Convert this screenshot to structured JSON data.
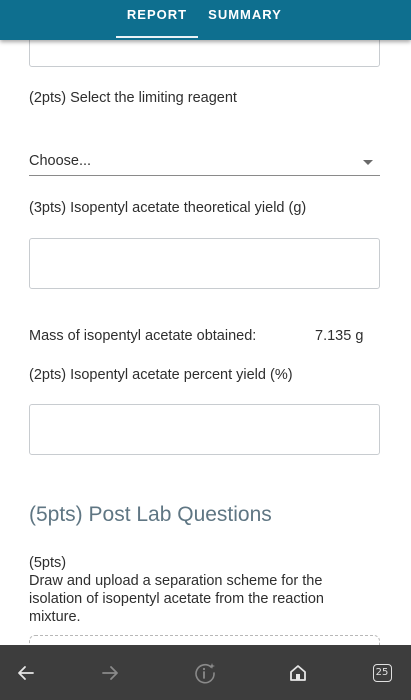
{
  "tabs": [
    {
      "label": "REPORT",
      "active": true
    },
    {
      "label": "SUMMARY",
      "active": false
    }
  ],
  "questions": {
    "limiting_reagent": {
      "label": "(2pts)  Select the limiting reagent",
      "selected": "Choose..."
    },
    "theoretical_yield": {
      "label": "(3pts)  Isopentyl acetate theoretical yield (g)",
      "value": ""
    },
    "mass_obtained": {
      "label": "Mass of isopentyl acetate obtained:",
      "value": "7.135 g"
    },
    "percent_yield": {
      "label": "(2pts)  Isopentyl acetate percent yield (%)",
      "value": ""
    }
  },
  "post_lab": {
    "title": "(5pts) Post Lab Questions",
    "question_points": "(5pts)",
    "question_text": "Draw and upload a separation scheme for the isolation of isopentyl acetate from the reaction mixture."
  },
  "browser_toolbar": {
    "tab_count": "25",
    "icons": [
      "back-arrow-icon",
      "forward-arrow-icon",
      "info-sparkle-icon",
      "home-icon",
      "tabs-icon"
    ]
  },
  "colors": {
    "header": "#0e6f8f",
    "section_title": "#5f7683",
    "toolbar": "#3d3d3d"
  }
}
